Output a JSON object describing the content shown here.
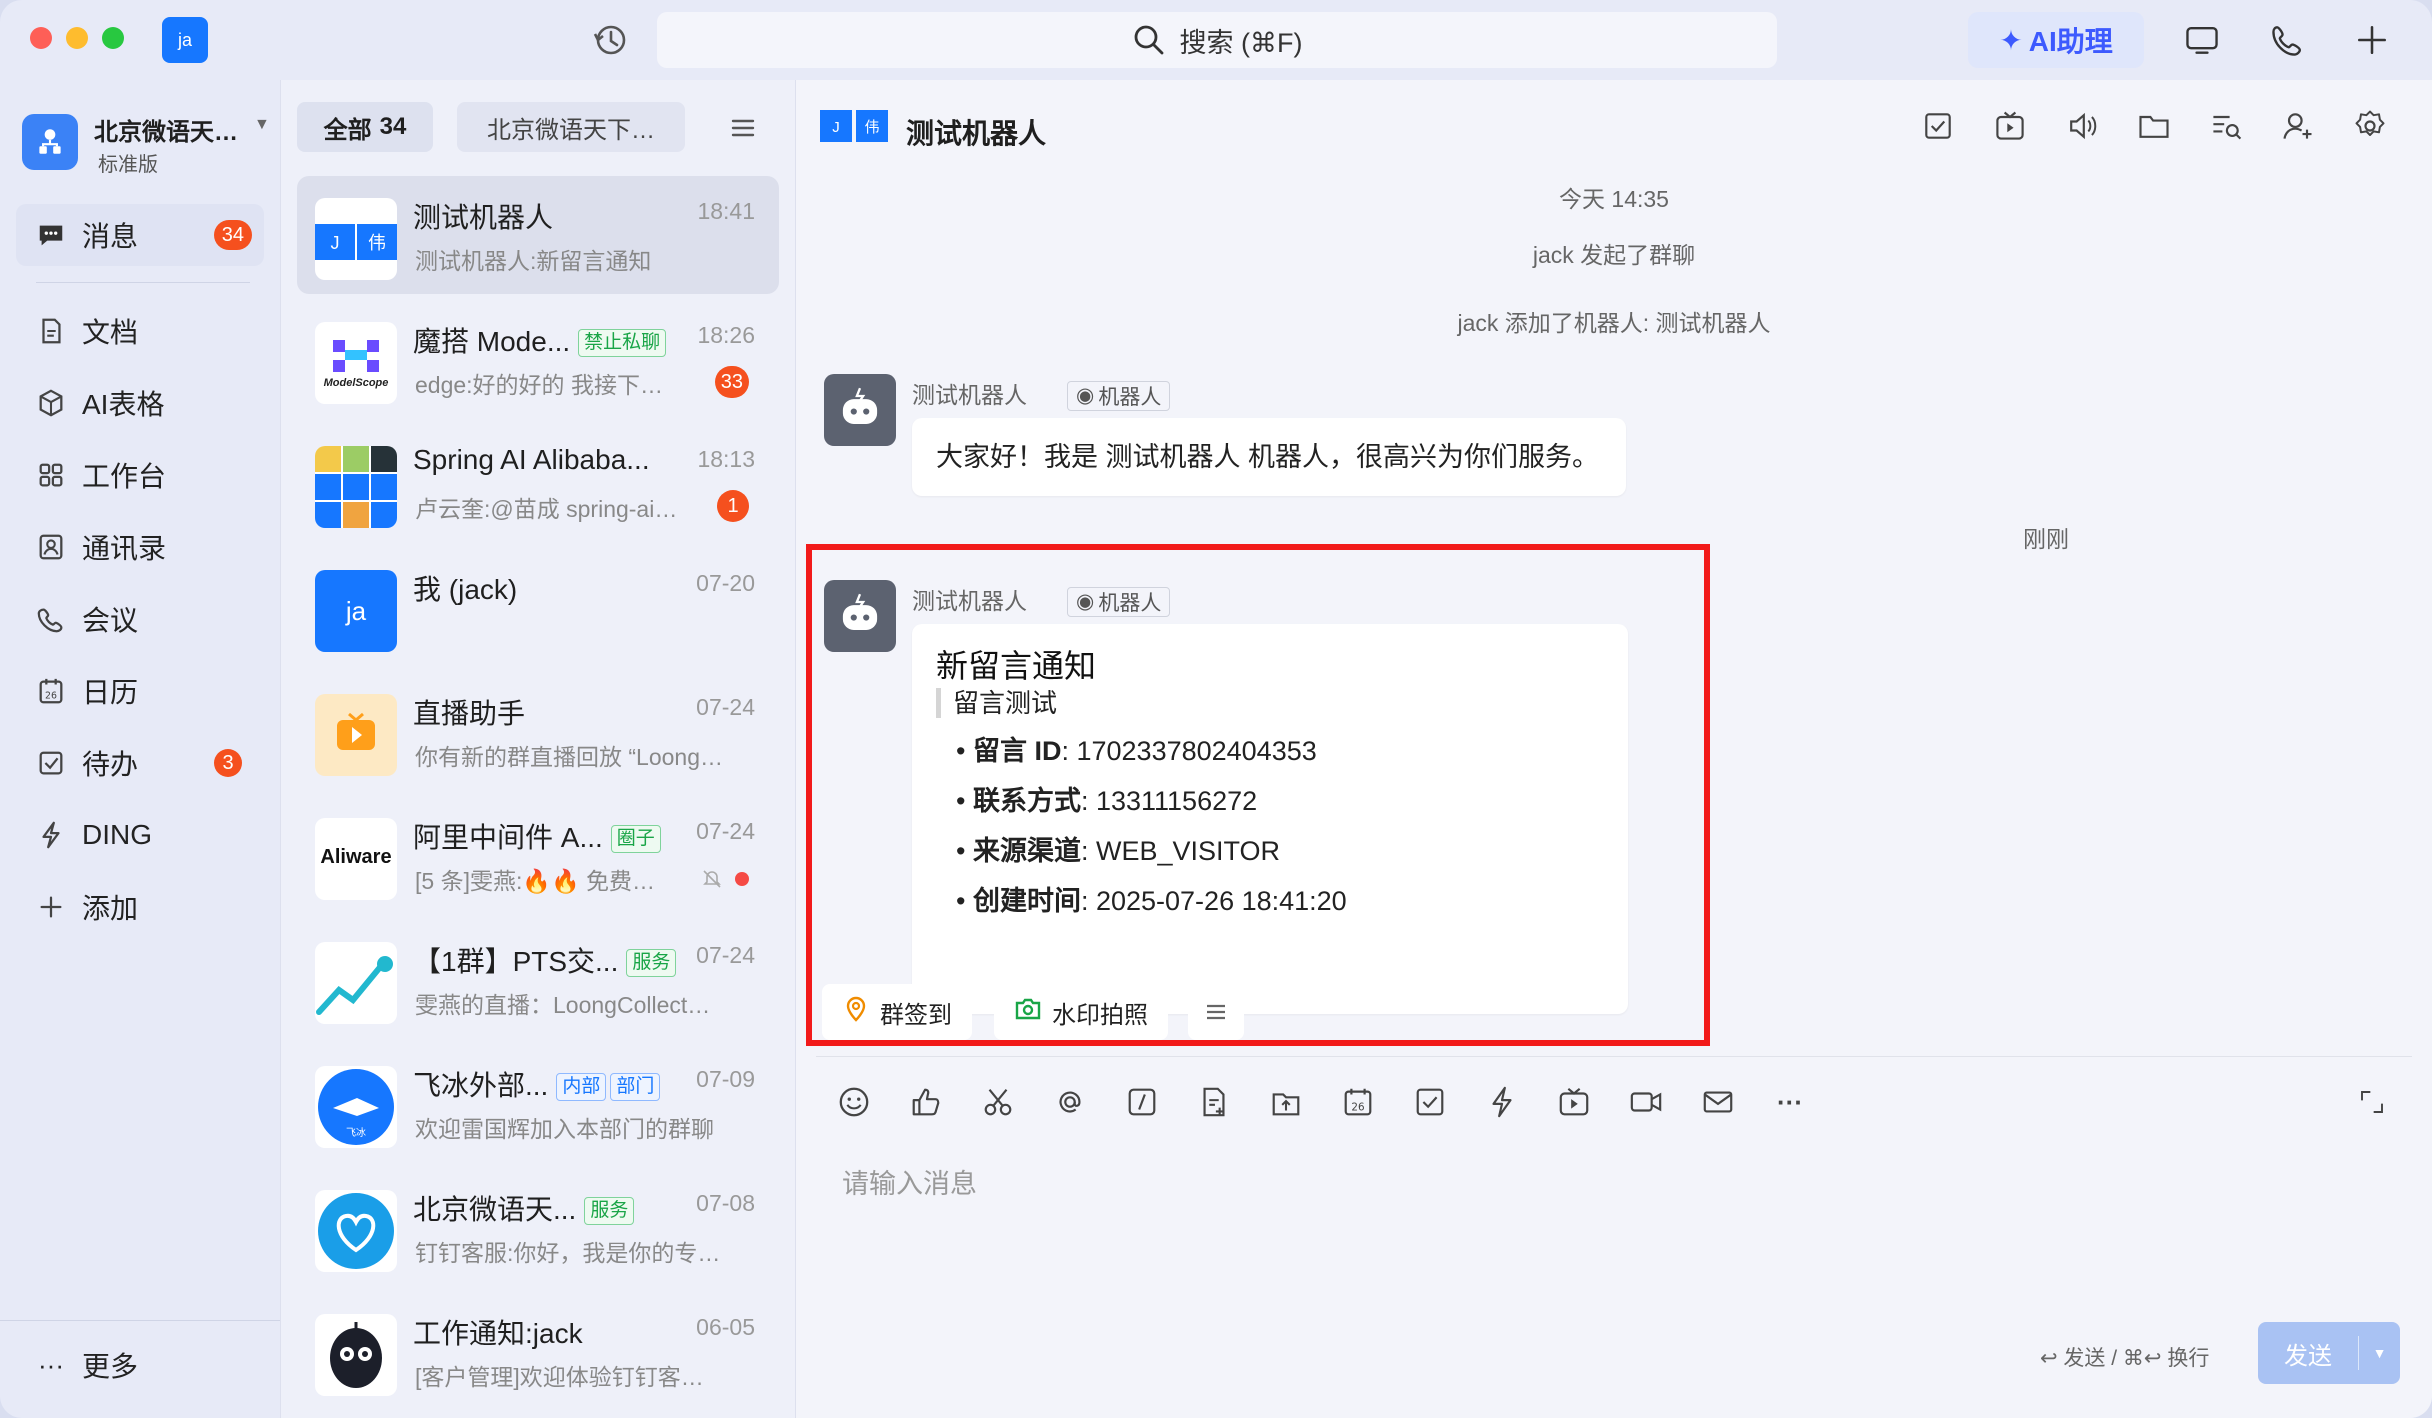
{
  "window": {
    "app_avatar": "ja",
    "search_placeholder": "搜索 (⌘F)",
    "ai_assistant": "AI助理",
    "icons": [
      "history-icon",
      "search-icon",
      "sparkle-icon",
      "screen-share-icon",
      "phone-icon",
      "plus-icon"
    ]
  },
  "sidebar": {
    "org_name": "北京微语天…",
    "org_plan": "标准版",
    "items": [
      {
        "label": "消息",
        "badge": "34",
        "icon": "message-icon"
      },
      {
        "label": "文档",
        "icon": "doc-icon"
      },
      {
        "label": "AI表格",
        "icon": "ai-table-icon"
      },
      {
        "label": "工作台",
        "icon": "workbench-icon"
      },
      {
        "label": "通讯录",
        "icon": "contacts-icon"
      },
      {
        "label": "会议",
        "icon": "meeting-icon"
      },
      {
        "label": "日历",
        "icon": "calendar-icon"
      },
      {
        "label": "待办",
        "badge": "3",
        "icon": "todo-icon"
      },
      {
        "label": "DING",
        "icon": "ding-icon"
      },
      {
        "label": "添加",
        "icon": "add-icon"
      }
    ],
    "more": "更多"
  },
  "conversations": {
    "tab_all_label": "全部",
    "tab_all_count": "34",
    "tab_org": "北京微语天下…",
    "items": [
      {
        "name": "测试机器人",
        "time": "18:41",
        "preview": "测试机器人:新留言通知",
        "avatar": "jw"
      },
      {
        "name": "魔搭 Mode...",
        "tag": "禁止私聊",
        "time": "18:26",
        "preview": "edge:好的好的 我接下…",
        "badge": "33",
        "avatar": "ModelScope"
      },
      {
        "name": "Spring AI Alibaba...",
        "time": "18:13",
        "preview": "卢云奎:@苗成  spring-ai…",
        "badge": "1",
        "avatar": "grid"
      },
      {
        "name": "我 (jack)",
        "time": "07-20",
        "preview": "",
        "avatar": "ja"
      },
      {
        "name": "直播助手",
        "time": "07-24",
        "preview": "你有新的群直播回放 “Loong…",
        "avatar": "live"
      },
      {
        "name": "阿里中间件 A...",
        "tag": "圈子",
        "time": "07-24",
        "preview": "[5 条]雯燕:🔥🔥 免费…",
        "avatar": "Aliware"
      },
      {
        "name": "【1群】PTS交...",
        "tag": "服务",
        "time": "07-24",
        "preview": "雯燕的直播：LoongCollect…",
        "avatar": "chart"
      },
      {
        "name": "飞冰外部...",
        "tag": "内部",
        "tag2": "部门",
        "time": "07-09",
        "preview": "欢迎雷国辉加入本部门的群聊",
        "avatar": "飞冰"
      },
      {
        "name": "北京微语天...",
        "tag": "服务",
        "time": "07-08",
        "preview": "钉钉客服:你好，我是你的专…",
        "avatar": "heart"
      },
      {
        "name": "工作通知:jack",
        "time": "06-05",
        "preview": "[客户管理]欢迎体验钉钉客…",
        "avatar": "robot"
      }
    ]
  },
  "chat": {
    "title": "测试机器人",
    "header_avatar": {
      "left": "J",
      "right": "伟"
    },
    "timestamp": "今天 14:35",
    "system_messages": [
      "jack 发起了群聊",
      "jack 添加了机器人: 测试机器人"
    ],
    "message1": {
      "sender": "测试机器人",
      "tag": "机器人",
      "text": "大家好！我是 测试机器人 机器人，很高兴为你们服务。"
    },
    "just_now": "刚刚",
    "message2": {
      "sender": "测试机器人",
      "tag": "机器人",
      "card_title": "新留言通知",
      "card_quote": "留言测试",
      "fields": [
        {
          "label": "留言 ID",
          "value": ": 1702337802404353"
        },
        {
          "label": "联系方式",
          "value": ": 13311156272"
        },
        {
          "label": "来源渠道",
          "value": ": WEB_VISITOR"
        },
        {
          "label": "创建时间",
          "value": ": 2025-07-26 18:41:20"
        }
      ]
    },
    "quick_actions": [
      "群签到",
      "水印拍照"
    ],
    "input_placeholder": "请输入消息",
    "send_hint": "↩ 发送 / ⌘↩ 换行",
    "send_label": "发送",
    "highlight_color": "#f21a1a"
  }
}
